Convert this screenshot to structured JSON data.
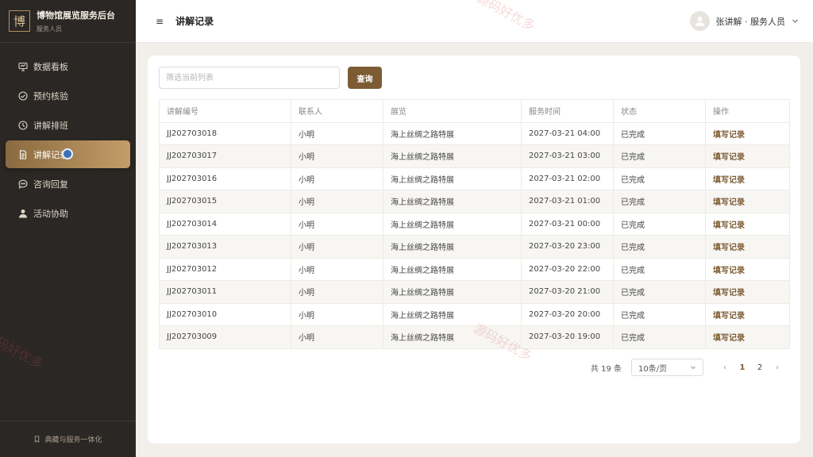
{
  "brand": {
    "logo_char": "博",
    "title": "博物馆展览服务后台",
    "subtitle": "服务人员"
  },
  "sidebar": {
    "items": [
      {
        "label": "数据看板",
        "icon": "dashboard-icon"
      },
      {
        "label": "预约核验",
        "icon": "check-circle-icon"
      },
      {
        "label": "讲解排班",
        "icon": "clock-icon"
      },
      {
        "label": "讲解记录",
        "icon": "document-icon",
        "active": true
      },
      {
        "label": "咨询回复",
        "icon": "chat-icon"
      },
      {
        "label": "活动协助",
        "icon": "user-icon"
      }
    ],
    "footer": "典藏与服务一体化"
  },
  "header": {
    "menu_icon": "≡",
    "title": "讲解记录",
    "user_label": "张讲解 · 服务人员"
  },
  "filter": {
    "placeholder": "筛选当前列表",
    "button": "查询"
  },
  "table": {
    "columns": [
      "讲解编号",
      "联系人",
      "展览",
      "服务时间",
      "状态",
      "操作"
    ],
    "rows": [
      {
        "id": "JJ202703018",
        "contact": "小明",
        "exhibit": "海上丝绸之路特展",
        "time": "2027-03-21 04:00",
        "status": "已完成",
        "action": "填写记录"
      },
      {
        "id": "JJ202703017",
        "contact": "小明",
        "exhibit": "海上丝绸之路特展",
        "time": "2027-03-21 03:00",
        "status": "已完成",
        "action": "填写记录"
      },
      {
        "id": "JJ202703016",
        "contact": "小明",
        "exhibit": "海上丝绸之路特展",
        "time": "2027-03-21 02:00",
        "status": "已完成",
        "action": "填写记录"
      },
      {
        "id": "JJ202703015",
        "contact": "小明",
        "exhibit": "海上丝绸之路特展",
        "time": "2027-03-21 01:00",
        "status": "已完成",
        "action": "填写记录"
      },
      {
        "id": "JJ202703014",
        "contact": "小明",
        "exhibit": "海上丝绸之路特展",
        "time": "2027-03-21 00:00",
        "status": "已完成",
        "action": "填写记录"
      },
      {
        "id": "JJ202703013",
        "contact": "小明",
        "exhibit": "海上丝绸之路特展",
        "time": "2027-03-20 23:00",
        "status": "已完成",
        "action": "填写记录"
      },
      {
        "id": "JJ202703012",
        "contact": "小明",
        "exhibit": "海上丝绸之路特展",
        "time": "2027-03-20 22:00",
        "status": "已完成",
        "action": "填写记录"
      },
      {
        "id": "JJ202703011",
        "contact": "小明",
        "exhibit": "海上丝绸之路特展",
        "time": "2027-03-20 21:00",
        "status": "已完成",
        "action": "填写记录"
      },
      {
        "id": "JJ202703010",
        "contact": "小明",
        "exhibit": "海上丝绸之路特展",
        "time": "2027-03-20 20:00",
        "status": "已完成",
        "action": "填写记录"
      },
      {
        "id": "JJ202703009",
        "contact": "小明",
        "exhibit": "海上丝绸之路特展",
        "time": "2027-03-20 19:00",
        "status": "已完成",
        "action": "填写记录"
      }
    ]
  },
  "pagination": {
    "total": "共 19 条",
    "page_size": "10条/页",
    "pages": [
      "1",
      "2"
    ],
    "current": "1"
  },
  "watermark": "源码好优多",
  "colors": {
    "sidebar_bg": "#2b2724",
    "accent": "#7d5c33",
    "active_gradient_start": "#8a6a40",
    "active_gradient_end": "#c49d68",
    "page_bg": "#f2efea"
  }
}
